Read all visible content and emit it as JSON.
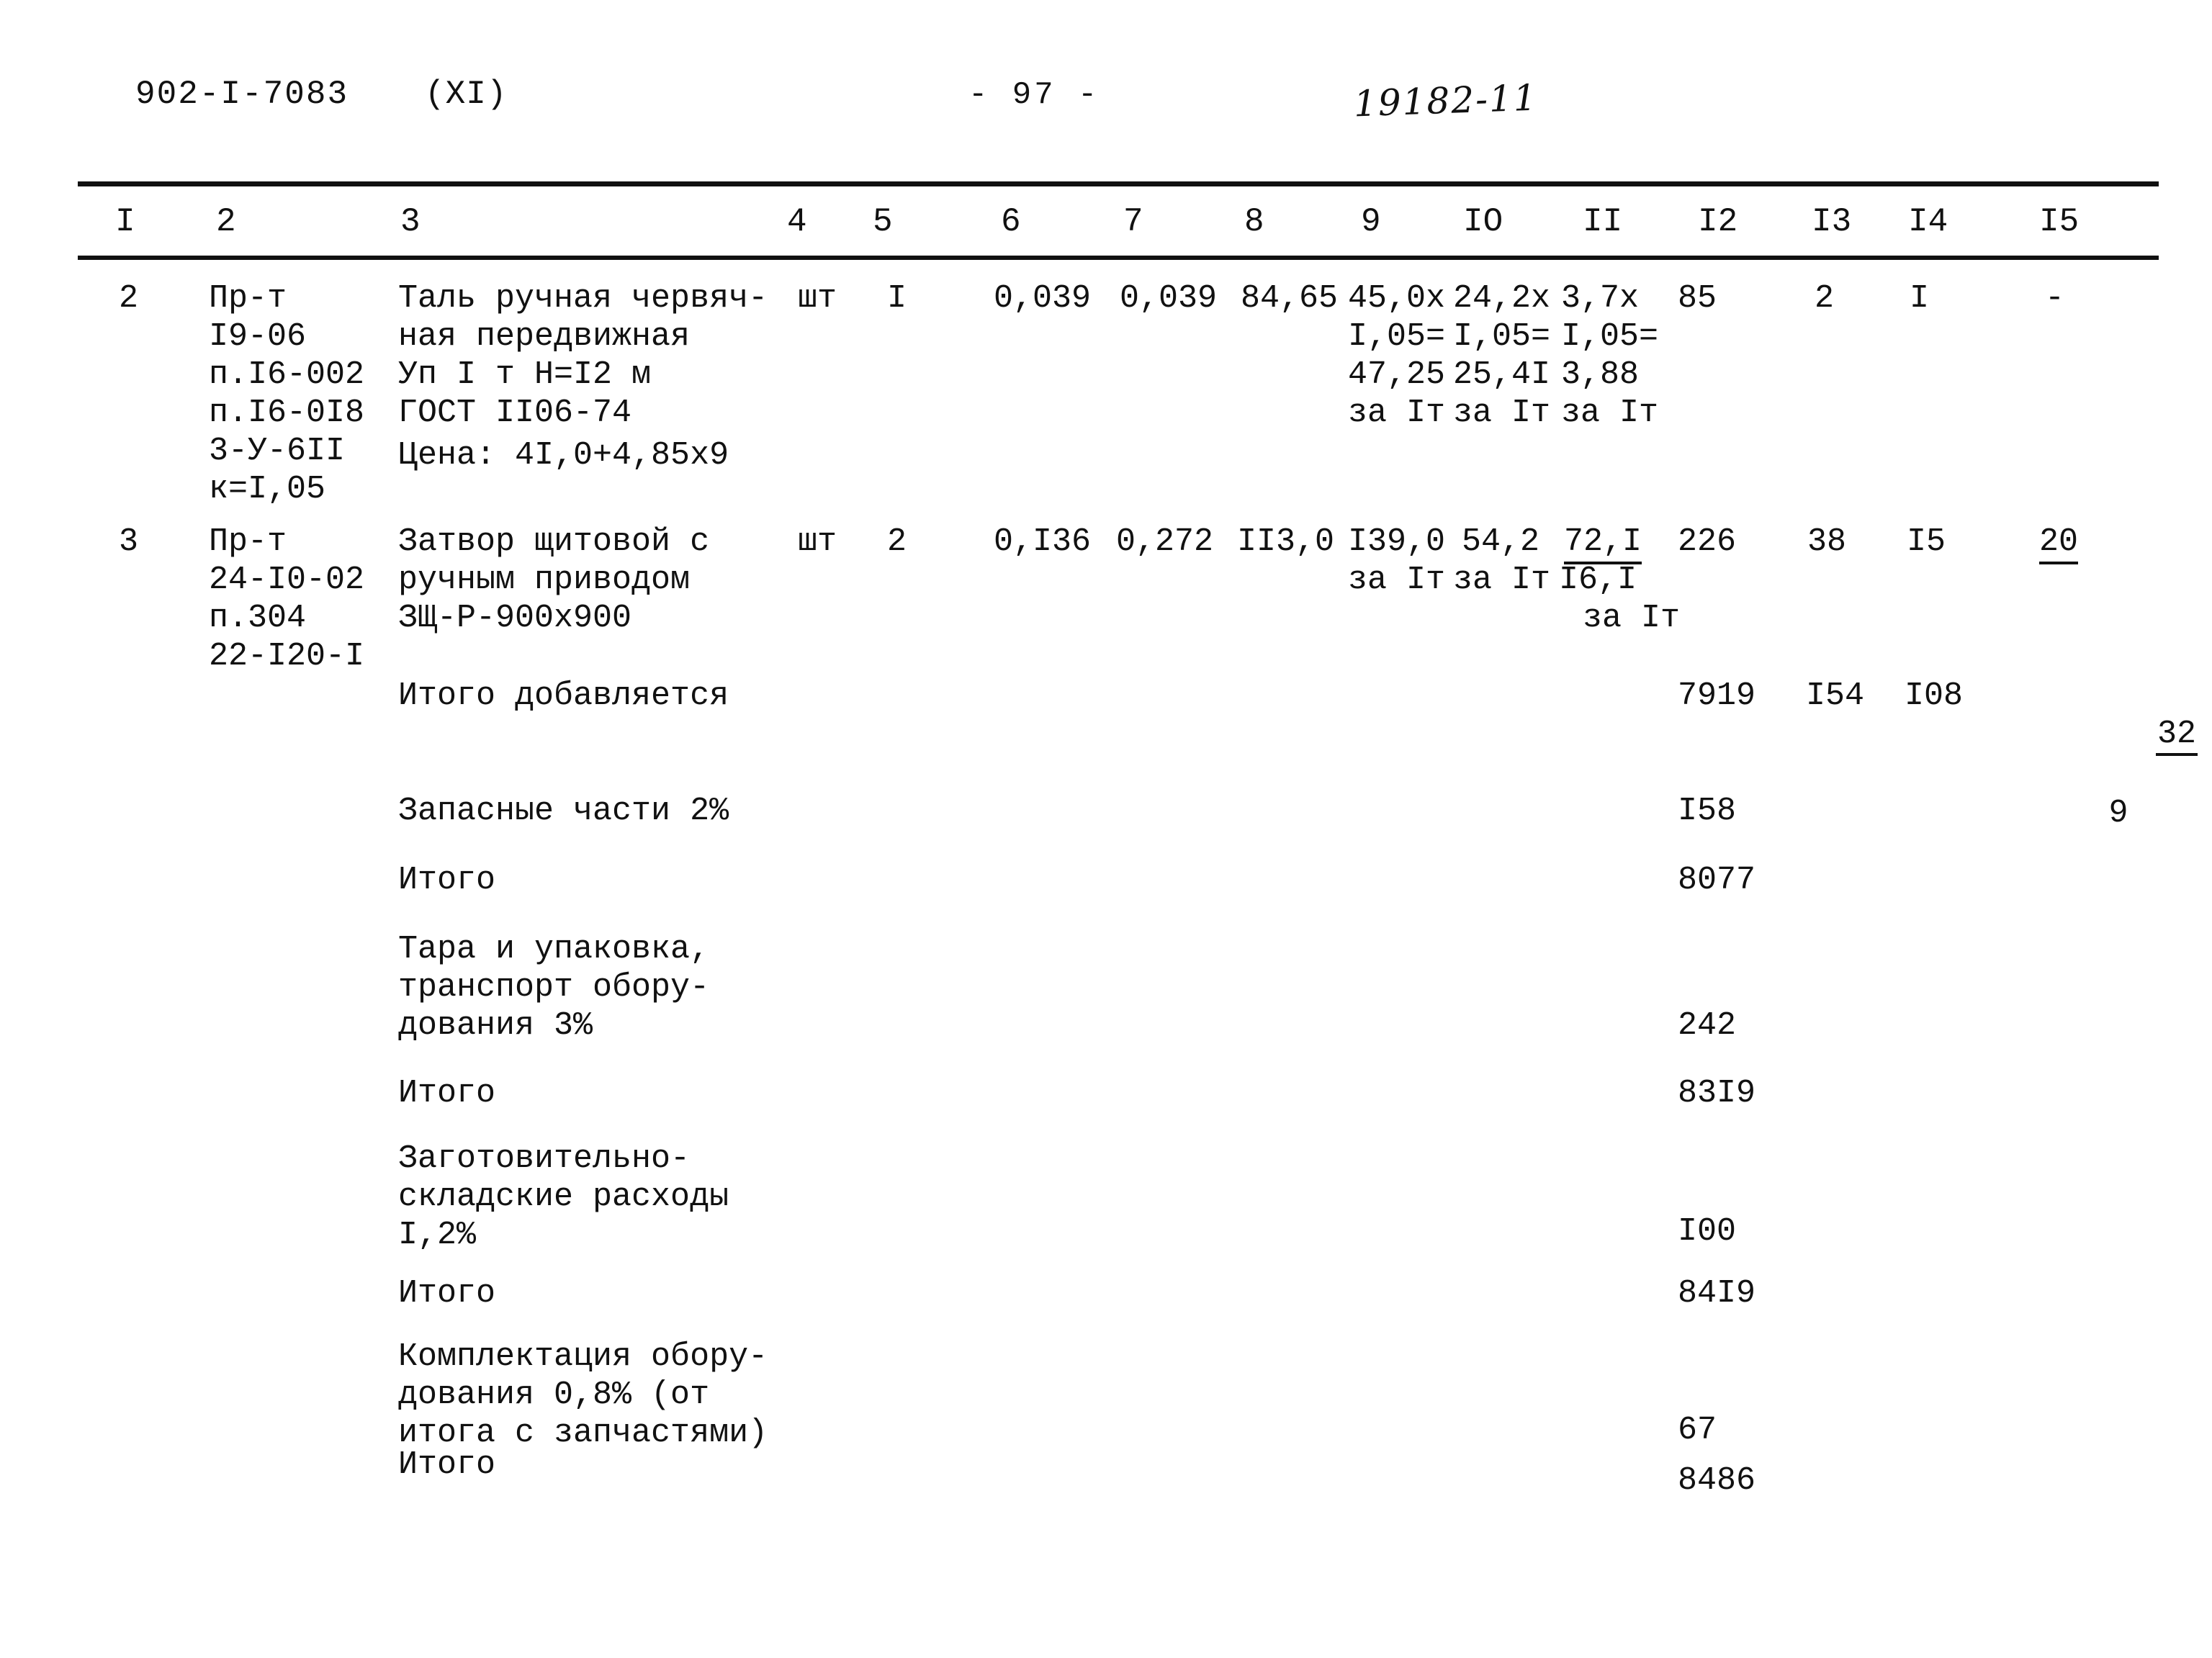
{
  "header": {
    "doc_code": "902-I-7083",
    "volume": "(XI)",
    "page_number": "- 97 -",
    "stamp": "19182-11"
  },
  "table": {
    "column_headers": [
      "I",
      "2",
      "3",
      "4",
      "5",
      "6",
      "7",
      "8",
      "9",
      "IO",
      "II",
      "I2",
      "I3",
      "I4",
      "I5"
    ],
    "rows": [
      {
        "c1": "2",
        "c2": "Пр-т\nI9-06\nп.I6-002\nп.I6-0I8\n3-У-6II\nк=I,05",
        "c3": "Таль ручная червяч-\nная передвижная\nУп I т H=I2 м\nГОСТ II06-74",
        "c3b": "Цена: 4I,0+4,85x9",
        "c4": "шт",
        "c5": "I",
        "c6": "0,039",
        "c7": "0,039",
        "c8": "84,65",
        "c9": "45,0x\nI,05=\n47,25\nза Iт",
        "c10": "24,2x\nI,05=\n25,4I\nза Iт",
        "c11": "3,7x\nI,05=\n3,88\nза Iт",
        "c12": "85",
        "c13": "2",
        "c14": "I",
        "c15": "-"
      },
      {
        "c1": "3",
        "c2": "Пр-т\n24-I0-02\nп.304\n22-I20-I",
        "c3": "Затвор щитовой с\nручным приводом\nЗЩ-Р-900x900",
        "c4": "шт",
        "c5": "2",
        "c6": "0,I36",
        "c7": "0,272",
        "c8": "II3,0",
        "c9": "I39,0",
        "c9b": "за Iт",
        "c10": "54,2",
        "c10b": "за Iт",
        "c11": "72,I",
        "c11b": "I6,I",
        "c11c": "за Iт",
        "c12": "226",
        "c13": "38",
        "c14": "I5",
        "c15": "20"
      }
    ],
    "summary": [
      {
        "label": "Итого добавляется",
        "c12": "7919",
        "c13": "I54",
        "c14": "I08",
        "c15_num": "32",
        "c15_den": "9"
      },
      {
        "label": "Запасные части 2%",
        "c12": "I58"
      },
      {
        "label": "Итого",
        "c12": "8077"
      },
      {
        "label": "Тара и упаковка,\nтранспорт обору-\nдования 3%",
        "c12": "242"
      },
      {
        "label": "Итого",
        "c12": "83I9"
      },
      {
        "label": "Заготовительно-\nскладские расходы\nI,2%",
        "c12": "I00"
      },
      {
        "label": "Итого",
        "c12": "84I9"
      },
      {
        "label": "Комплектация обору-\nдования 0,8% (от\nитога с запчастями)",
        "c12": "67"
      },
      {
        "label": "Итого",
        "c12": "8486"
      }
    ]
  }
}
